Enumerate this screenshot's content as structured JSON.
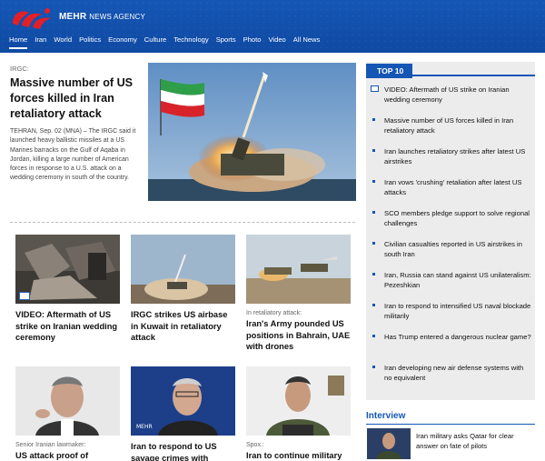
{
  "brand": {
    "name": "MEHR",
    "sub": "NEWS AGENCY"
  },
  "nav": [
    "Home",
    "Iran",
    "World",
    "Politics",
    "Economy",
    "Culture",
    "Technology",
    "Sports",
    "Photo",
    "Video",
    "All News"
  ],
  "lead": {
    "kicker": "IRGC:",
    "title": "Massive number of US forces killed in Iran retaliatory attack",
    "text": "TEHRAN, Sep. 02 (MNA) – The IRGC said it launched heavy ballistic missiles at a US Marines barracks on the Gulf of Aqaba in Jordan, killing a large number of American forces in response to a U.S. attack on a wedding ceremony in south of the country."
  },
  "cards": [
    {
      "kicker": "",
      "title": "VIDEO: Aftermath of US strike on Iranian wedding ceremony"
    },
    {
      "kicker": "",
      "title": "IRGC strikes US airbase in Kuwait in retaliatory attack"
    },
    {
      "kicker": "In retaliatory attack:",
      "title": "Iran's Army pounded US positions in Bahrain, UAE with drones"
    },
    {
      "kicker": "Senior Iranian lawmaker:",
      "title": "US attack proof of"
    },
    {
      "kicker": "",
      "title": "Iran to respond to US savage crimes with"
    },
    {
      "kicker": "Spox.:",
      "title": "Iran to continue military"
    }
  ],
  "top10": {
    "label": "TOP 10",
    "items": [
      "VIDEO: Aftermath of US strike on Iranian wedding ceremony",
      "Massive number of US forces killed in Iran retaliatory attack",
      "Iran launches retaliatory strikes after latest US airstrikes",
      "Iran vows 'crushing' retaliation after latest US attacks",
      "SCO members pledge support to solve regional challenges",
      "Civilian casualties reported in US airstrikes in south Iran",
      "Iran, Russia can stand against US unilateralism: Pezeshkian",
      "Iran to respond to intensified US naval blockade militarily",
      "Has Trump entered a dangerous nuclear game?",
      "Iran developing new air defense systems with no equivalent"
    ]
  },
  "interview": {
    "label": "Interview",
    "text": "Iran military asks Qatar for clear answer on fate of pilots"
  },
  "colors": {
    "brand_blue": "#1556b5",
    "logo_red": "#e41e26"
  }
}
